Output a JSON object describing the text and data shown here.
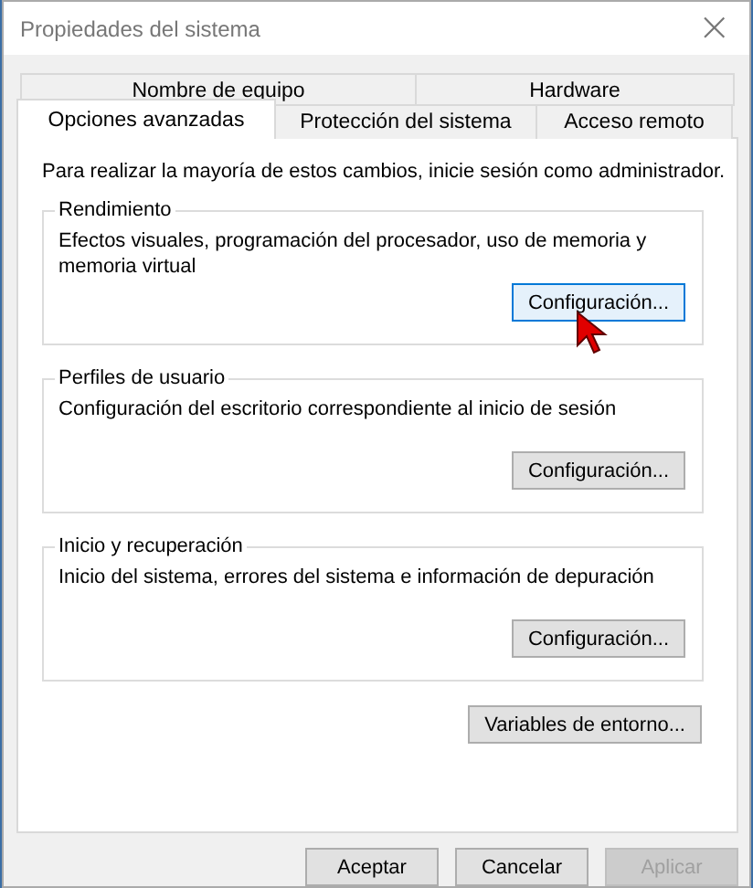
{
  "window": {
    "title": "Propiedades del sistema",
    "close": "×"
  },
  "tab_rows": [
    [
      {
        "label": "Nombre de equipo",
        "selected": false
      },
      {
        "label": "Hardware",
        "selected": false
      }
    ],
    [
      {
        "label": "Opciones avanzadas",
        "selected": true
      },
      {
        "label": "Protección del sistema",
        "selected": false
      },
      {
        "label": "Acceso remoto",
        "selected": false
      }
    ]
  ],
  "notice": "Para realizar la mayoría de estos cambios, inicie sesión como administrador.",
  "groups": [
    {
      "title": "Rendimiento",
      "description": "Efectos visuales, programación del procesador, uso de memoria y memoria virtual",
      "button": {
        "label": "Configuración...",
        "highlighted": true
      }
    },
    {
      "title": "Perfiles de usuario",
      "description": "Configuración del escritorio correspondiente al inicio de sesión",
      "button": {
        "label": "Configuración...",
        "highlighted": false
      }
    },
    {
      "title": "Inicio y recuperación",
      "description": "Inicio del sistema, errores del sistema e información de depuración",
      "button": {
        "label": "Configuración...",
        "highlighted": false
      }
    }
  ],
  "env_button": {
    "label": "Variables de entorno..."
  },
  "footer_buttons": [
    {
      "label": "Aceptar",
      "disabled": false
    },
    {
      "label": "Cancelar",
      "disabled": false
    },
    {
      "label": "Aplicar",
      "disabled": true
    }
  ]
}
